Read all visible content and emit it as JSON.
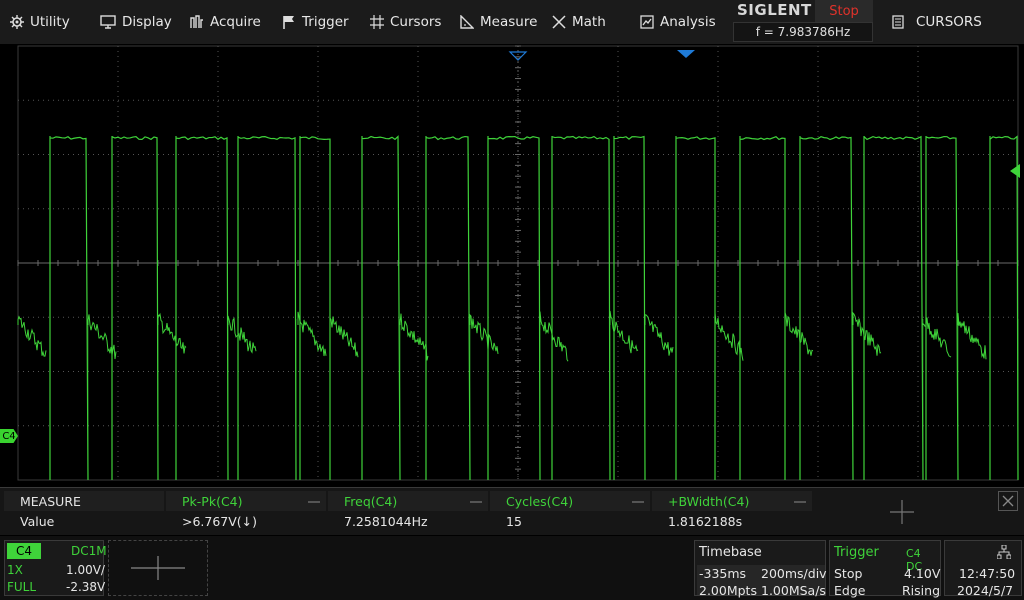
{
  "menu": {
    "utility": "Utility",
    "display": "Display",
    "acquire": "Acquire",
    "trigger": "Trigger",
    "cursors": "Cursors",
    "measure": "Measure",
    "math": "Math",
    "analysis": "Analysis"
  },
  "brand": {
    "name": "SIGLENT",
    "run_state": "Stop",
    "frequency": "f = 7.983786Hz"
  },
  "side_button": {
    "label": "CURSORS"
  },
  "channel_marker": "C4",
  "measure": {
    "title": "MEASURE",
    "row_label": "Value",
    "columns": [
      {
        "header": "Pk-Pk(C4)",
        "value": ">6.767V(↓)"
      },
      {
        "header": "Freq(C4)",
        "value": "7.2581044Hz"
      },
      {
        "header": "Cycles(C4)",
        "value": "15"
      },
      {
        "header": "+BWidth(C4)",
        "value": "1.8162188s"
      }
    ]
  },
  "channel": {
    "name": "C4",
    "coupling": "DC1M",
    "probe": "1X",
    "scale": "1.00V/",
    "bandwidth": "FULL",
    "offset": "-2.38V"
  },
  "timebase": {
    "title": "Timebase",
    "delay": "-335ms",
    "scale": "200ms/div",
    "memory": "2.00Mpts",
    "sample_rate": "1.00MSa/s"
  },
  "trigger": {
    "title": "Trigger",
    "source": "C4 DC",
    "mode": "Stop",
    "level": "4.10V",
    "type": "Edge",
    "slope": "Rising"
  },
  "clock": {
    "time": "12:47:50",
    "date": "2024/5/7"
  },
  "colors": {
    "trace": "#3fd33a",
    "stop": "#e0322a",
    "trigger_marker": "#1f7bd8"
  }
}
